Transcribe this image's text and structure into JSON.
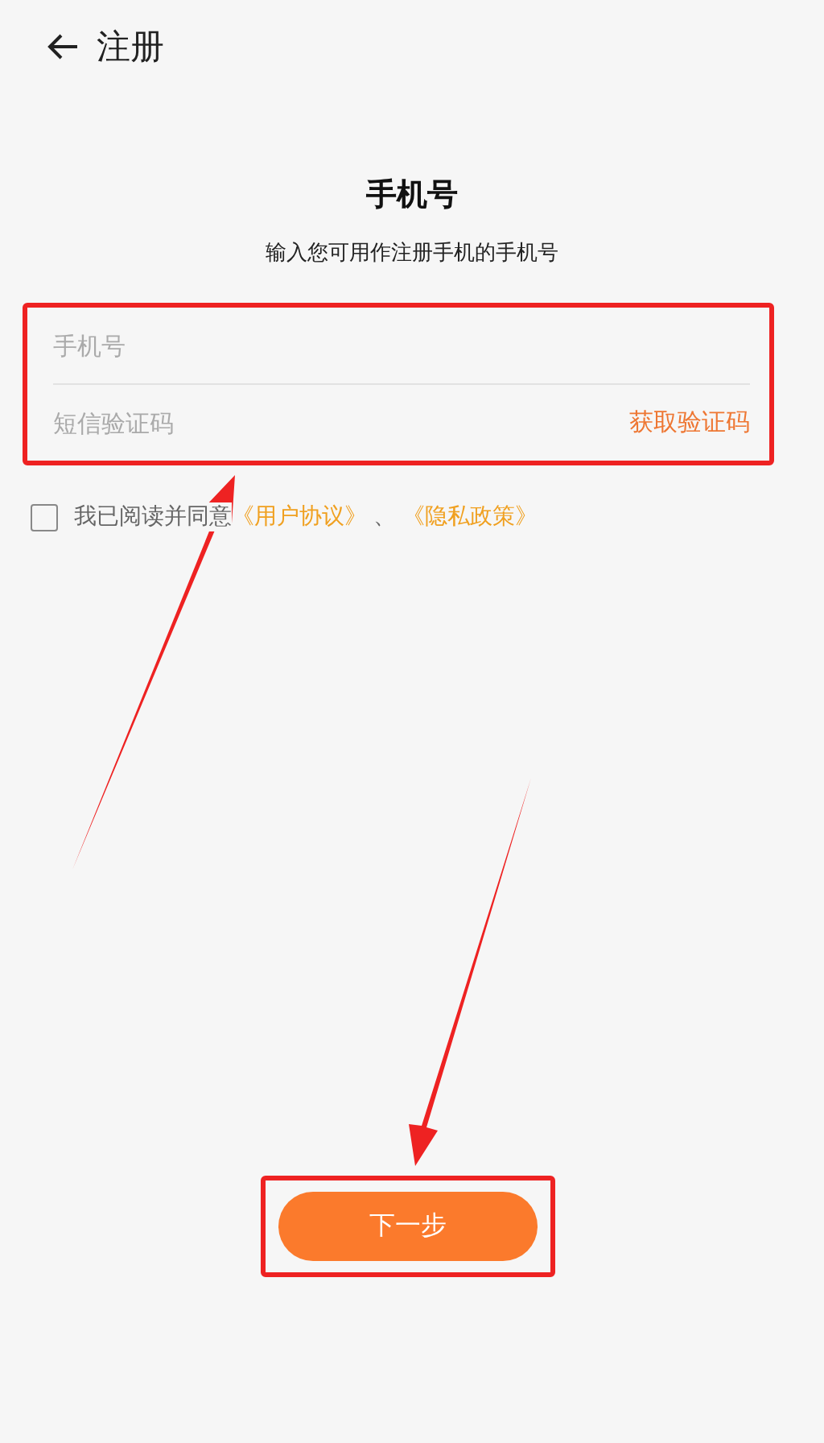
{
  "header": {
    "title": "注册"
  },
  "heading": "手机号",
  "subtitle": "输入您可用作注册手机的手机号",
  "form": {
    "phone": {
      "placeholder": "手机号"
    },
    "code": {
      "placeholder": "短信验证码"
    },
    "get_code": "获取验证码"
  },
  "agreement": {
    "checked": false,
    "text": "我已阅读并同意",
    "links": [
      "《用户协议》",
      "《隐私政策》"
    ],
    "separator": "、"
  },
  "next_button": "下一步"
}
